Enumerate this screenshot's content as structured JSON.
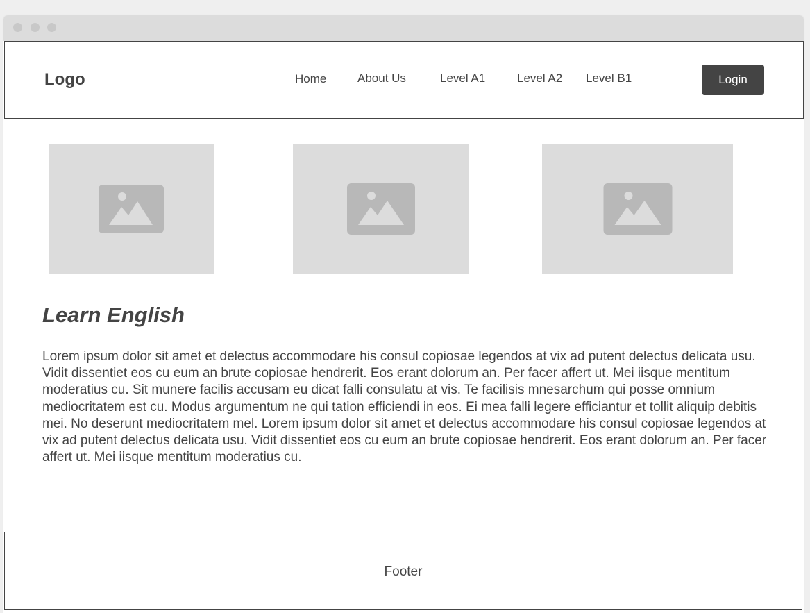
{
  "header": {
    "logo": "Logo",
    "nav": [
      "Home",
      "About Us",
      "Level A1",
      "Level A2",
      "Level B1"
    ],
    "login_label": "Login"
  },
  "images": [
    "image-placeholder",
    "image-placeholder",
    "image-placeholder"
  ],
  "main": {
    "title": "Learn English",
    "paragraph": "Lorem ipsum dolor sit amet et delectus accommodare his consul copiosae legendos at vix ad putent delectus delicata usu. Vidit dissentiet eos cu eum an brute copiosae hendrerit. Eos erant dolorum an. Per facer affert ut. Mei iisque mentitum moderatius cu. Sit munere facilis accusam eu dicat falli consulatu at vis. Te facilisis mnesarchum qui posse omnium mediocritatem est cu. Modus argumentum ne qui tation efficiendi in eos. Ei mea falli legere efficiantur et tollit aliquip debitis mei. No deserunt mediocritatem mel. Lorem ipsum dolor sit amet et delectus accommodare his consul copiosae legendos at vix ad putent delectus delicata usu. Vidit dissentiet eos cu eum an brute copiosae hendrerit. Eos erant dolorum an. Per facer affert ut. Mei iisque mentitum moderatius cu."
  },
  "footer": {
    "label": "Footer"
  },
  "colors": {
    "text": "#444444",
    "placeholder_bg": "#dcdcdc",
    "placeholder_icon": "#b8b8b8",
    "button_bg": "#444444",
    "button_text": "#ffffff"
  }
}
